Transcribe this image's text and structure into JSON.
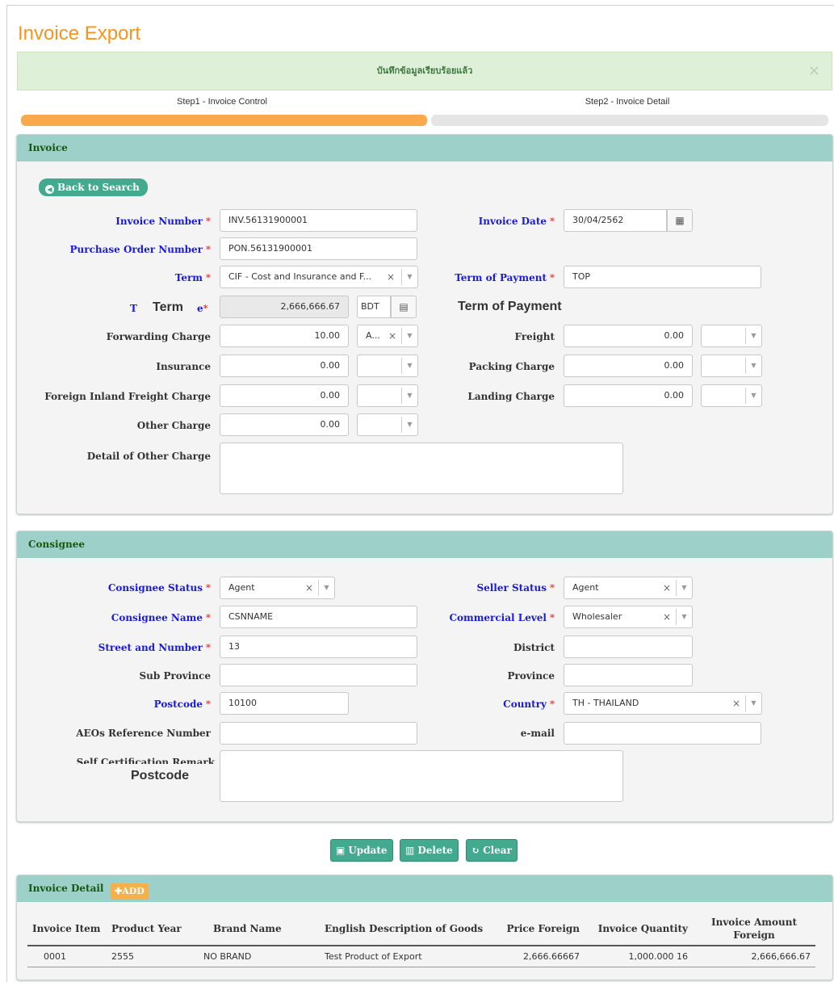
{
  "page": {
    "title": "Invoice Export"
  },
  "alert": {
    "message": "บันทึกข้อมูลเรียบร้อยแล้ว",
    "close": "×"
  },
  "steps": [
    {
      "label": "Step1 - Invoice Control",
      "active": true,
      "color": "#f9a84b"
    },
    {
      "label": "Step2 - Invoice Detail",
      "active": false,
      "color": "#e5e5e5"
    }
  ],
  "invoice": {
    "heading": "Invoice",
    "back_button": "Back to Search",
    "invoice_number": {
      "label": "Invoice Number",
      "value": "INV.56131900001"
    },
    "invoice_date": {
      "label": "Invoice Date",
      "value": "30/04/2562",
      "icon": "calendar-icon"
    },
    "po_number": {
      "label": "Purchase Order Number",
      "value": "PON.56131900001"
    },
    "term": {
      "label": "Term",
      "value": "CIF - Cost and Insurance and F..."
    },
    "term_of_payment": {
      "label": "Term of Payment",
      "value": "TOP"
    },
    "total": {
      "label_prefix": "T",
      "label_suffix": "e",
      "value": "2,666,666.67",
      "currency": "BDT"
    },
    "overlay_term": "Term",
    "overlay_term_of_payment": "Term of Payment",
    "forwarding_charge": {
      "label": "Forwarding Charge",
      "value": "10.00",
      "unit": "A..."
    },
    "freight": {
      "label": "Freight",
      "value": "0.00"
    },
    "insurance": {
      "label": "Insurance",
      "value": "0.00"
    },
    "packing_charge": {
      "label": "Packing Charge",
      "value": "0.00"
    },
    "foreign_inland": {
      "label": "Foreign Inland Freight Charge",
      "value": "0.00"
    },
    "landing_charge": {
      "label": "Landing Charge",
      "value": "0.00"
    },
    "other_charge": {
      "label": "Other Charge",
      "value": "0.00"
    },
    "detail_other": {
      "label": "Detail of Other Charge",
      "value": ""
    }
  },
  "consignee": {
    "heading": "Consignee",
    "consignee_status": {
      "label": "Consignee Status",
      "value": "Agent"
    },
    "seller_status": {
      "label": "Seller Status",
      "value": "Agent"
    },
    "consignee_name": {
      "label": "Consignee Name",
      "value": "CSNNAME"
    },
    "commercial_level": {
      "label": "Commercial Level",
      "value": "Wholesaler"
    },
    "street": {
      "label": "Street and Number",
      "value": "13"
    },
    "district": {
      "label": "District",
      "value": ""
    },
    "sub_province": {
      "label": "Sub Province",
      "value": ""
    },
    "province": {
      "label": "Province",
      "value": ""
    },
    "postcode": {
      "label": "Postcode",
      "value": "10100"
    },
    "country": {
      "label": "Country",
      "value": "TH - THAILAND"
    },
    "aeo": {
      "label": "AEOs Reference Number",
      "value": ""
    },
    "email": {
      "label": "e-mail",
      "value": ""
    },
    "self_cert": {
      "label": "Self Certification Remark",
      "value": ""
    },
    "overlay_postcode": "Postcode"
  },
  "actions": {
    "update": "Update",
    "delete": "Delete",
    "clear": "Clear"
  },
  "detail": {
    "heading": "Invoice Detail",
    "add": "ADD",
    "columns": [
      "Invoice Item",
      "Product Year",
      "Brand Name",
      "English Description of Goods",
      "Price Foreign",
      "Invoice Quantity",
      "Invoice Amount Foreign"
    ],
    "rows": [
      [
        "0001",
        "2555",
        "NO BRAND",
        "Test Product of Export",
        "2,666.66667",
        "1,000.000 16",
        "2,666,666.67"
      ]
    ]
  },
  "colors": {
    "accent": "#f7931e",
    "panel_header": "#9dd0c8",
    "button": "#43a98f",
    "required": "#e02020",
    "label_blue": "#1a1adc"
  }
}
